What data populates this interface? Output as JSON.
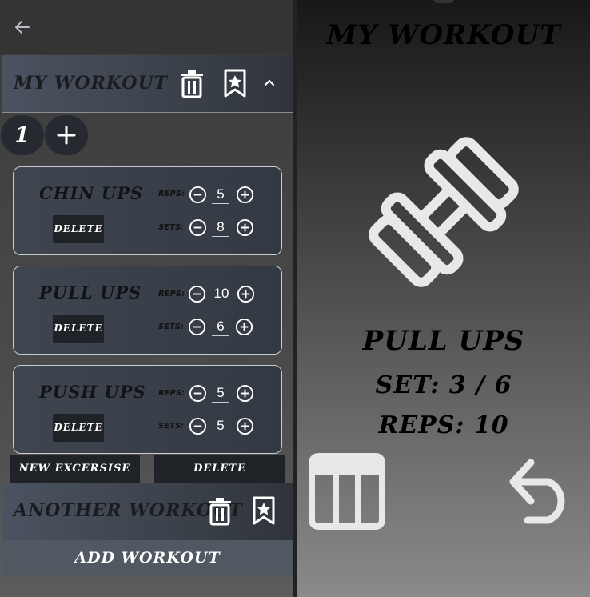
{
  "left": {
    "workouts": [
      {
        "title": "MY WORKOUT",
        "set_count": "1",
        "exercises": [
          {
            "name": "CHIN UPS",
            "reps_label": "REPS:",
            "reps": "5",
            "sets_label": "SETS:",
            "sets": "8",
            "delete_label": "DELETE"
          },
          {
            "name": "PULL UPS",
            "reps_label": "REPS:",
            "reps": "10",
            "sets_label": "SETS:",
            "sets": "6",
            "delete_label": "DELETE"
          },
          {
            "name": "PUSH UPS",
            "reps_label": "REPS:",
            "reps": "5",
            "sets_label": "SETS:",
            "sets": "5",
            "delete_label": "DELETE"
          }
        ],
        "new_exercise_label": "NEW EXCERSISE",
        "delete_label": "DELETE"
      },
      {
        "title": "ANOTHER WORKOUT"
      }
    ],
    "add_workout_label": "ADD WORKOUT"
  },
  "right": {
    "title": "MY WORKOUT",
    "current_exercise": "PULL UPS",
    "set_text": "SET: 3 / 6",
    "reps_text": "REPS: 10"
  },
  "icons": {
    "back": "arrow-left-icon",
    "delete": "trash-icon",
    "bookmark": "bookmark-star-icon",
    "collapse": "chevron-up-icon",
    "add": "plus-icon",
    "minus": "minus-circle-icon",
    "plus": "plus-circle-icon",
    "dumbbell": "dumbbell-icon",
    "table": "table-icon",
    "undo": "undo-icon"
  }
}
